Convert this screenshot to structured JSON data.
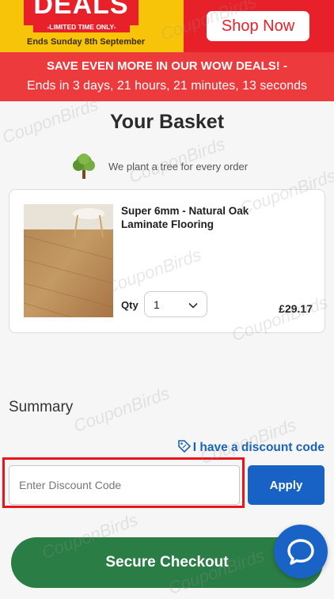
{
  "promo": {
    "deals_title": "DEALS",
    "limited_label": "-LIMITED TIME ONLY-",
    "ends_text": "Ends Sunday 8th September",
    "shop_now_label": "Shop Now"
  },
  "save_banner": {
    "title": "SAVE EVEN MORE IN OUR WOW DEALS! -",
    "countdown": "Ends in 3 days, 21 hours, 21 minutes, 13 seconds"
  },
  "page_title": "Your Basket",
  "tree_message": "We plant a tree for every order",
  "basket": {
    "items": [
      {
        "name": "Super 6mm - Natural Oak Laminate Flooring",
        "qty_label": "Qty",
        "qty_value": "1",
        "price": "£29.17"
      }
    ]
  },
  "summary": {
    "title": "Summary",
    "discount_link": "I have a discount code",
    "discount_placeholder": "Enter Discount Code",
    "apply_label": "Apply",
    "checkout_label": "Secure Checkout"
  },
  "watermark": "CouponBirds",
  "colors": {
    "promo_yellow": "#f7c40a",
    "promo_red": "#e8202a",
    "save_banner": "#ec3a3d",
    "link_blue": "#1b63b8",
    "apply_blue": "#1762c4",
    "checkout_green": "#2b7d46",
    "highlight_red": "#e8151b"
  },
  "icons": {
    "tree": "tree-icon",
    "qty_chevron": "chevron-down-icon",
    "discount_tag": "tag-icon",
    "chat": "chat-bubble-icon"
  }
}
